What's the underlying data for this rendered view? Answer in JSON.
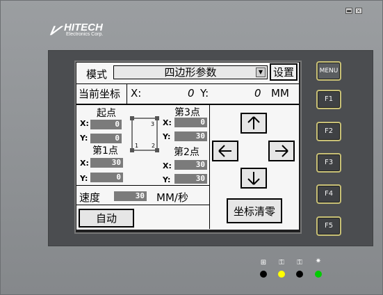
{
  "hardware": {
    "brand_logo": "HITECH",
    "brand_subtitle": "Electronics Corp.",
    "window_controls": [
      "minimize-icon",
      "close-icon"
    ],
    "function_keys": [
      "MENU",
      "F1",
      "F2",
      "F3",
      "F4",
      "F5"
    ],
    "status_indicators": [
      {
        "icon": "network-icon",
        "color": "#000000"
      },
      {
        "icon": "key-icon",
        "color": "#ffff00"
      },
      {
        "icon": "key-icon",
        "color": "#000000"
      },
      {
        "icon": "power-icon",
        "color": "#00cc00"
      }
    ]
  },
  "screen": {
    "mode_label": "模式",
    "mode_value": "四边形参数",
    "settings_button": "设置",
    "current_coords_label": "当前坐标",
    "x_label": "X:",
    "x_value": "0",
    "y_label": "Y:",
    "y_value": "0",
    "unit": "MM",
    "start_point": {
      "title": "起点",
      "x": "0",
      "y": "0"
    },
    "point3": {
      "title": "第3点",
      "x": "0",
      "y": "30"
    },
    "point1": {
      "title": "第1点",
      "x": "30",
      "y": "0"
    },
    "point2": {
      "title": "第2点",
      "x": "30",
      "y": "30"
    },
    "coord_x": "X:",
    "coord_y": "Y:",
    "diagram_labels": {
      "p1": "1",
      "p2": "2",
      "p3": "3"
    },
    "speed_label": "速度",
    "speed_value": "30",
    "speed_unit": "MM/秒",
    "auto_button": "自动",
    "clear_coords_button": "坐标清零",
    "arrow_icons": [
      "arrow-up-icon",
      "arrow-left-icon",
      "arrow-right-icon",
      "arrow-down-icon"
    ]
  }
}
